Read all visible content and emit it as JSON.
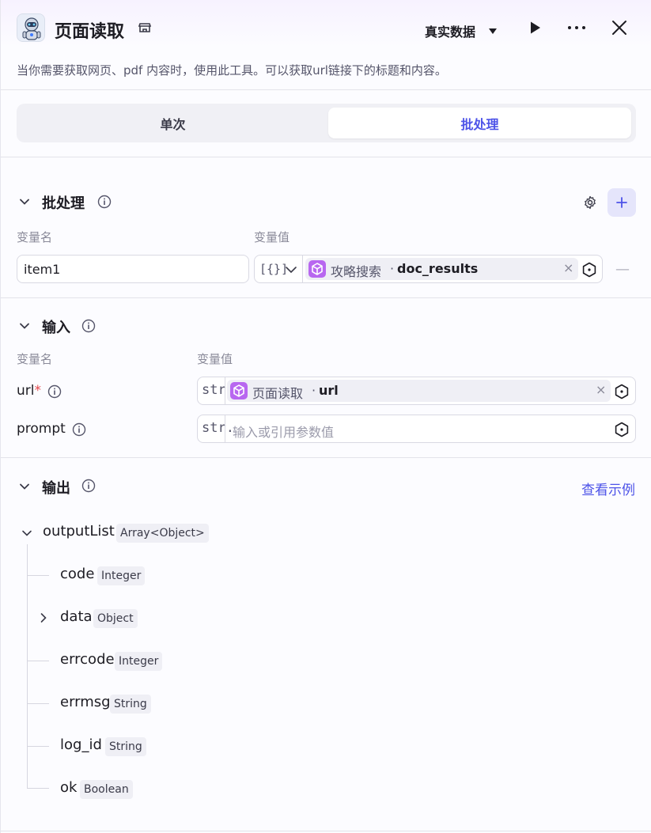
{
  "header": {
    "title": "页面读取",
    "data_mode": "真实数据",
    "description": "当你需要获取网页、pdf 内容时，使用此工具。可以获取url链接下的标题和内容。"
  },
  "tabs": [
    {
      "label": "单次",
      "active": false
    },
    {
      "label": "批处理",
      "active": true
    }
  ],
  "batch": {
    "title": "批处理",
    "col_name": "变量名",
    "col_value": "变量值",
    "rows": [
      {
        "name": "item1",
        "type_tag": "[{}]",
        "ref_node": "攻略搜索",
        "ref_var": "doc_results"
      }
    ]
  },
  "input": {
    "title": "输入",
    "col_name": "变量名",
    "col_value": "变量值",
    "params": [
      {
        "name": "url",
        "required": true,
        "type_tag": "str.",
        "ref_node": "页面读取",
        "ref_var": "url",
        "placeholder": ""
      },
      {
        "name": "prompt",
        "required": false,
        "type_tag": "str.",
        "ref_node": "",
        "ref_var": "",
        "placeholder": "输入或引用参数值"
      }
    ]
  },
  "output": {
    "title": "输出",
    "view_example": "查看示例",
    "root": {
      "name": "outputList",
      "type": "Array<Object>"
    },
    "children": [
      {
        "name": "code",
        "type": "Integer",
        "expandable": false
      },
      {
        "name": "data",
        "type": "Object",
        "expandable": true
      },
      {
        "name": "errcode",
        "type": "Integer",
        "expandable": false
      },
      {
        "name": "errmsg",
        "type": "String",
        "expandable": false
      },
      {
        "name": "log_id",
        "type": "String",
        "expandable": false
      },
      {
        "name": "ok",
        "type": "Boolean",
        "expandable": false
      }
    ]
  },
  "colors": {
    "accent": "#4d53e8",
    "chip_icon": "#b867f0",
    "required": "#e5484d"
  }
}
